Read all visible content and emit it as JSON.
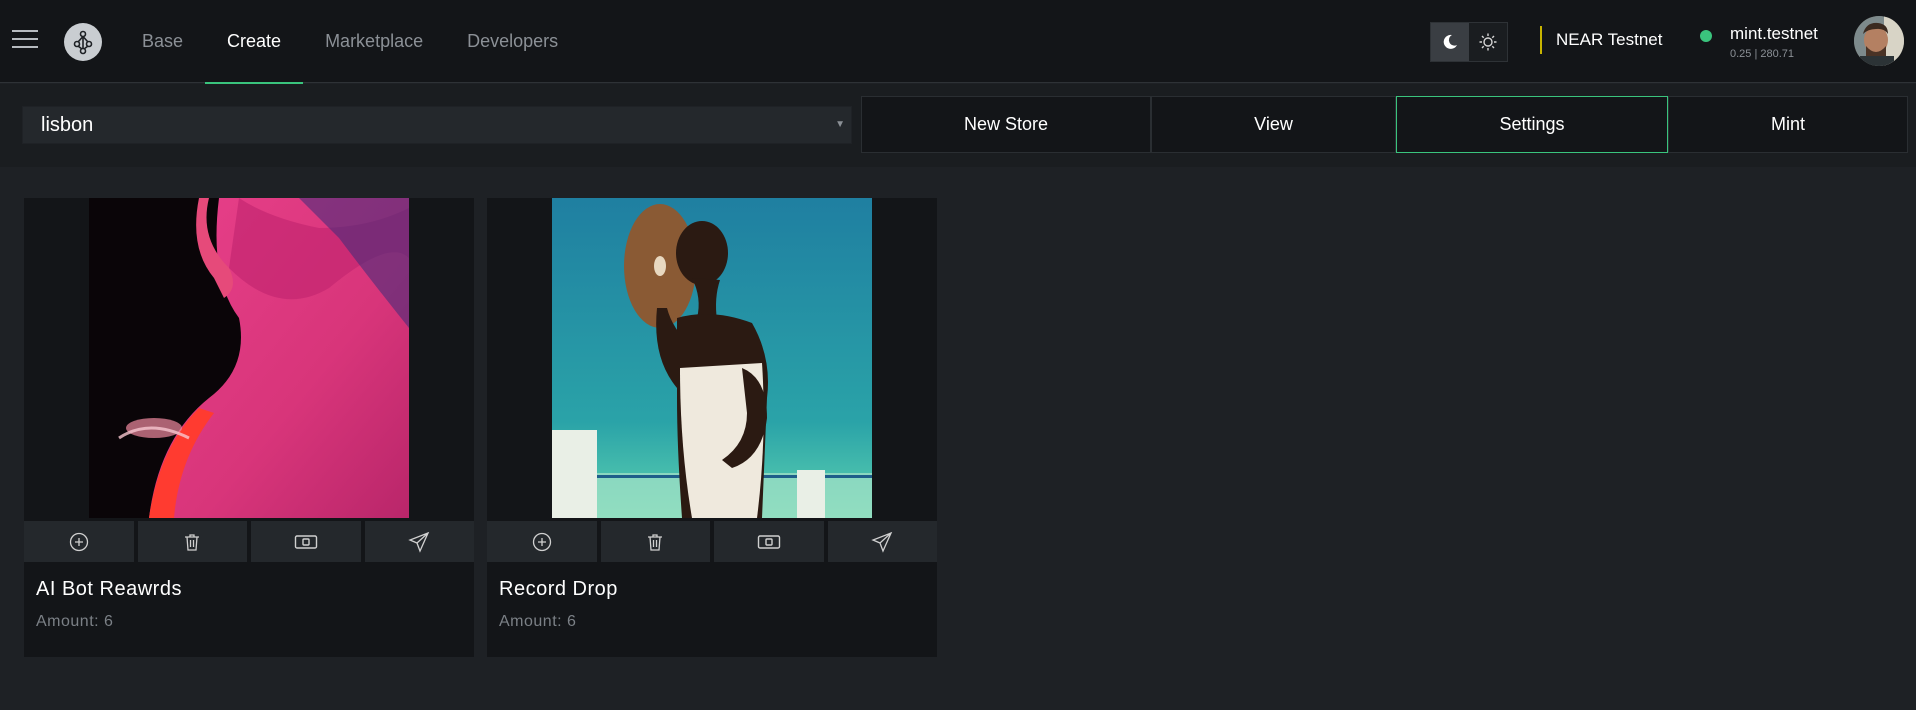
{
  "nav": {
    "items": [
      {
        "label": "Base",
        "active": false
      },
      {
        "label": "Create",
        "active": true
      },
      {
        "label": "Marketplace",
        "active": false
      },
      {
        "label": "Developers",
        "active": false
      }
    ]
  },
  "network": "NEAR Testnet",
  "account": {
    "name": "mint.testnet",
    "balance": "0.25 | 280.71",
    "status_color": "#3ac47d"
  },
  "theme": {
    "dark_icon": "moon-icon",
    "light_icon": "sun-icon",
    "selected": "dark"
  },
  "toolbar": {
    "store_value": "lisbon",
    "tabs": [
      "New Store",
      "View",
      "Settings",
      "Mint"
    ],
    "active_tab": "Settings"
  },
  "cards": [
    {
      "title": "AI Bot Reawrds",
      "amount": "Amount: 6"
    },
    {
      "title": "Record Drop",
      "amount": "Amount: 6"
    }
  ],
  "card_action_icons": [
    "plus-circle-icon",
    "trash-icon",
    "money-icon",
    "send-icon"
  ],
  "colors": {
    "accent": "#3ac47d",
    "network_bar": "#c8b400",
    "bg": "#1e2125",
    "panel": "#131518"
  }
}
